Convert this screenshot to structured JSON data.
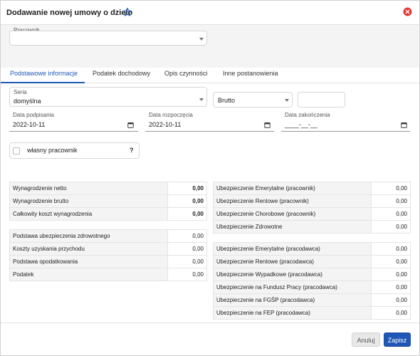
{
  "dialog": {
    "title": "Dodawanie nowej umowy o dzieło",
    "accent_color": "#1f57b6",
    "close_color": "#e53935",
    "star_icon": "star-outline-icon",
    "close_icon": "close-circle-icon"
  },
  "employee": {
    "label": "Pracownik",
    "value": ""
  },
  "tabs": [
    {
      "label": "Podstawowe informacje",
      "active": true
    },
    {
      "label": "Podatek dochodowy",
      "active": false
    },
    {
      "label": "Opis czynności",
      "active": false
    },
    {
      "label": "Inne postanowienia",
      "active": false
    }
  ],
  "form": {
    "series_label": "Seria",
    "series_value": "domyślna",
    "gross_value": "Brutto",
    "amount_value": "",
    "sign_date_label": "Data podpisania",
    "sign_date_value": "2022-10-11",
    "start_date_label": "Data rozpoczęcia",
    "start_date_value": "2022-10-11",
    "end_date_label": "Data zakończenia",
    "end_date_value": "____-__-__",
    "own_employee_label": "własny pracownik",
    "help_mark": "?"
  },
  "left_table_1": [
    {
      "label": "Wynagrodzenie netto",
      "value": "0,00"
    },
    {
      "label": "Wynagrodzenie brutto",
      "value": "0,00"
    },
    {
      "label": "Całkowity koszt wynagrodzenia",
      "value": "0,00"
    }
  ],
  "left_table_2": [
    {
      "label": "Podstawa ubezpieczenia zdrowotnego",
      "value": "0,00"
    },
    {
      "label": "Koszty uzyskania przychodu",
      "value": "0,00"
    },
    {
      "label": "Podstawa opodatkowania",
      "value": "0,00"
    },
    {
      "label": "Podatek",
      "value": "0,00"
    }
  ],
  "right_table_1": [
    {
      "label": "Ubezpieczenie Emerytalne (pracownik)",
      "value": "0,00"
    },
    {
      "label": "Ubezpieczenie Rentowe (pracownik)",
      "value": "0,00"
    },
    {
      "label": "Ubezpieczenie Chorobowe (pracownik)",
      "value": "0,00"
    },
    {
      "label": "Ubezpieczenie Zdrowotne",
      "value": "0,00"
    }
  ],
  "right_table_2": [
    {
      "label": "Ubezpieczenie Emerytalne (pracodawca)",
      "value": "0,00"
    },
    {
      "label": "Ubezpieczenie Rentowe (pracodawca)",
      "value": "0,00"
    },
    {
      "label": "Ubezpieczenie Wypadkowe (pracodawca)",
      "value": "0,00"
    },
    {
      "label": "Ubezpieczenie na Fundusz Pracy (pracodawca)",
      "value": "0,00"
    },
    {
      "label": "Ubezpieczenie na FGŚP (pracodawca)",
      "value": "0,00"
    },
    {
      "label": "Ubezpieczenie na FEP (pracodawca)",
      "value": "0,00"
    }
  ],
  "footer": {
    "cancel_label": "Anuluj",
    "save_label": "Zapisz"
  }
}
